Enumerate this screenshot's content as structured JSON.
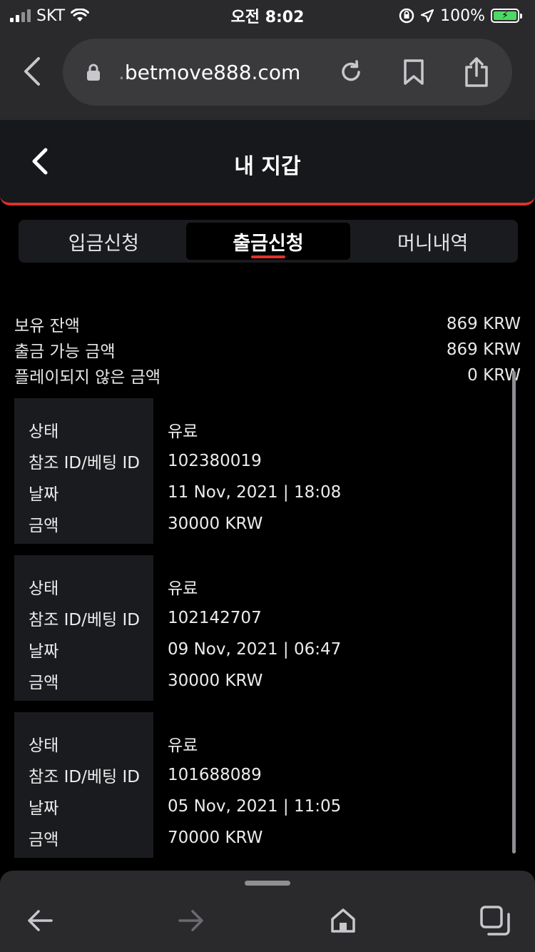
{
  "status_bar": {
    "carrier": "SKT",
    "time": "오전 8:02",
    "battery": "100%"
  },
  "browser": {
    "url_faded": ".",
    "url_domain": "betmove888.com"
  },
  "header": {
    "title": "내 지갑"
  },
  "tabs": [
    {
      "label": "입금신청",
      "active": false
    },
    {
      "label": "출금신청",
      "active": true
    },
    {
      "label": "머니내역",
      "active": false
    }
  ],
  "summary": [
    {
      "label": "보유 잔액",
      "value": "869 KRW"
    },
    {
      "label": "출금 가능 금액",
      "value": "869 KRW"
    },
    {
      "label": "플레이되지 않은 금액",
      "value": "0 KRW"
    }
  ],
  "record_labels": {
    "status": "상태",
    "ref_id": "참조 ID/베팅 ID",
    "date": "날짜",
    "amount": "금액"
  },
  "records": [
    {
      "status": "유료",
      "ref_id": "102380019",
      "date": "11 Nov, 2021 | 18:08",
      "amount": "30000 KRW"
    },
    {
      "status": "유료",
      "ref_id": "102142707",
      "date": "09 Nov, 2021 | 06:47",
      "amount": "30000 KRW"
    },
    {
      "status": "유료",
      "ref_id": "101688089",
      "date": "05 Nov, 2021 | 11:05",
      "amount": "70000 KRW"
    }
  ],
  "colors": {
    "accent": "#e0312b",
    "panel": "#1a1b1e",
    "chrome": "#2a2a2c"
  }
}
